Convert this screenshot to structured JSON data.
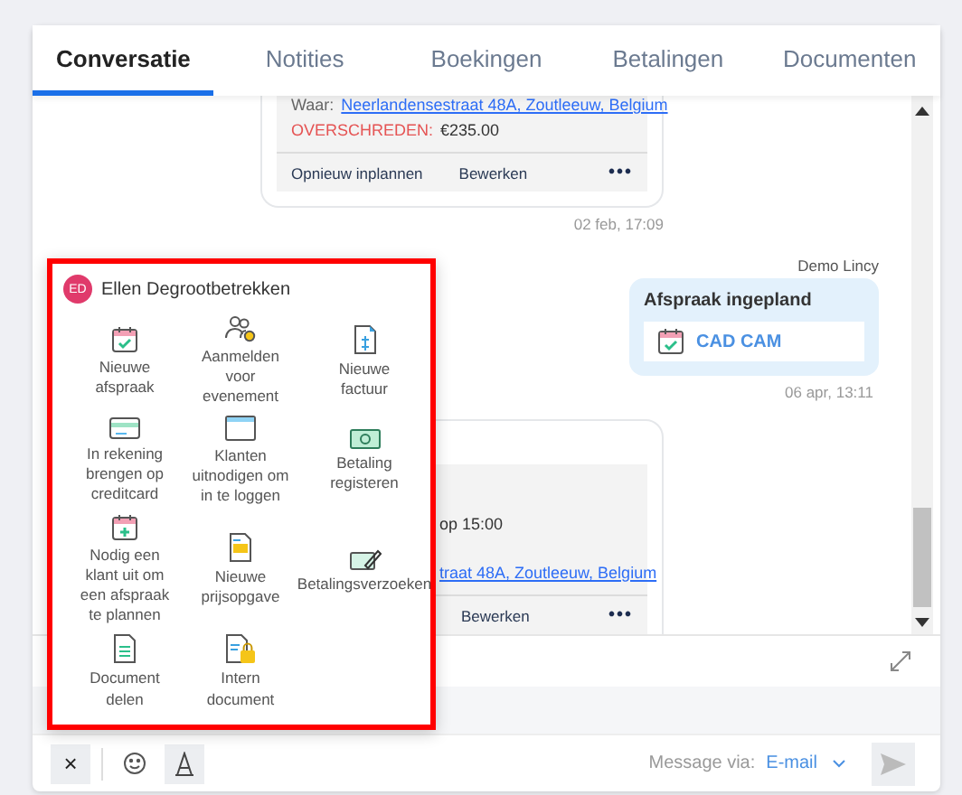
{
  "tabs": [
    {
      "label": "Conversatie",
      "selected": true
    },
    {
      "label": "Notities",
      "selected": false
    },
    {
      "label": "Boekingen",
      "selected": false
    },
    {
      "label": "Betalingen",
      "selected": false
    },
    {
      "label": "Documenten",
      "selected": false
    }
  ],
  "appointment_card": {
    "where_label": "Waar:",
    "address": "Neerlandensestraat 48A, Zoutleeuw, Belgium",
    "overdue_label": "OVERSCHREDEN:",
    "amount": "€235.00",
    "actions": [
      "Opnieuw inplannen",
      "Bewerken"
    ],
    "more": "•••",
    "time": "02 feb, 17:09"
  },
  "scheduled_message": {
    "sender": "Demo Lincy",
    "title": "Afspraak ingepland",
    "link": "CAD CAM",
    "time": "06 apr, 13:11"
  },
  "partial_card": {
    "time_text": "op 15:00",
    "address": "traat 48A, Zoutleeuw, Belgium",
    "actions": [
      "Bewerken"
    ],
    "more": "•••"
  },
  "quick_actions": {
    "contact": {
      "initials": "ED",
      "name": "Ellen Degrootbetrekken"
    },
    "items": [
      {
        "label": "Nieuwe afspraak"
      },
      {
        "label": "Aanmelden voor evenement"
      },
      {
        "label": "Nieuwe factuur"
      },
      {
        "label": "In rekening brengen op creditcard"
      },
      {
        "label": "Klanten uitnodigen om in te loggen"
      },
      {
        "label": "Betaling registeren"
      },
      {
        "label": "Nodig een klant uit om een afspraak te plannen"
      },
      {
        "label": "Nieuwe prijsopgave"
      },
      {
        "label": "Betalingsverzoeken"
      },
      {
        "label": "Document delen"
      },
      {
        "label": "Intern document"
      }
    ]
  },
  "composer": {
    "close": "×",
    "via_label": "Message via:",
    "channel": "E-mail"
  }
}
